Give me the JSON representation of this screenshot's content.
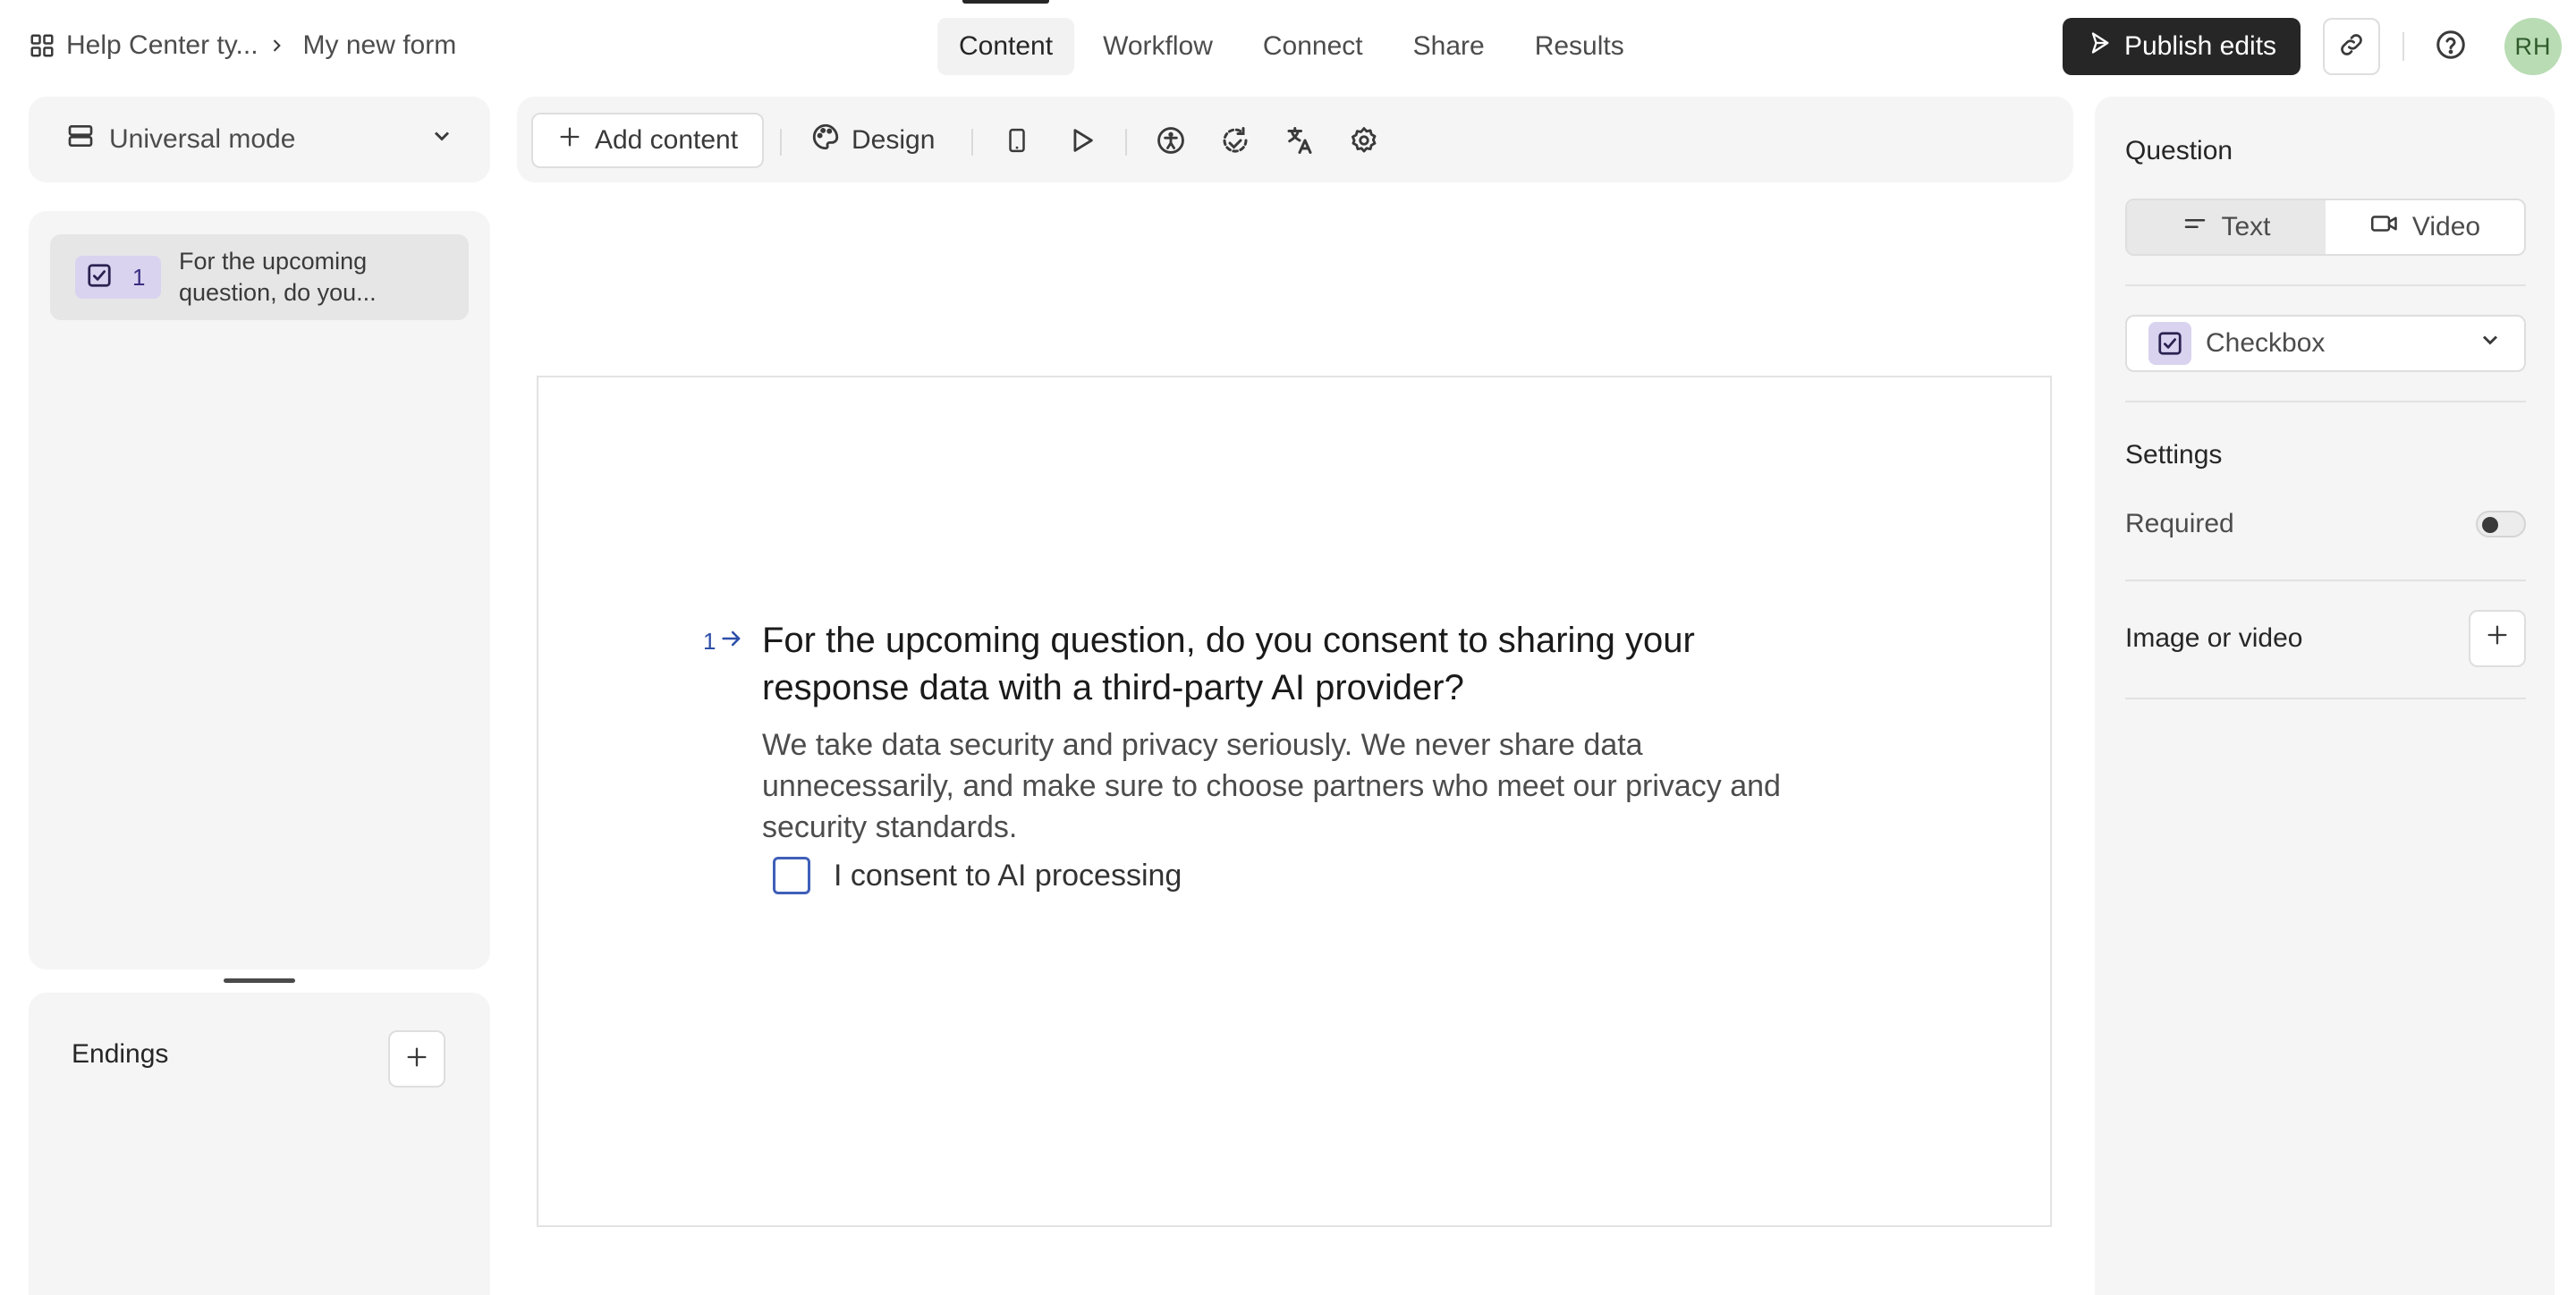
{
  "breadcrumb": {
    "workspace": "Help Center ty...",
    "form_name": "My new form"
  },
  "nav_tabs": [
    {
      "label": "Content",
      "active": true
    },
    {
      "label": "Workflow",
      "active": false
    },
    {
      "label": "Connect",
      "active": false
    },
    {
      "label": "Share",
      "active": false
    },
    {
      "label": "Results",
      "active": false
    }
  ],
  "header": {
    "publish_label": "Publish edits",
    "avatar_initials": "RH"
  },
  "mode": {
    "selected": "Universal mode"
  },
  "question_list": [
    {
      "number": "1",
      "type_icon": "checkbox-icon",
      "label": "For the upcoming question, do you..."
    }
  ],
  "endings": {
    "title": "Endings"
  },
  "toolbar": {
    "add_content_label": "Add content",
    "design_label": "Design"
  },
  "question": {
    "number": "1",
    "title": "For the upcoming question, do you consent to sharing your response data with a third-party AI provider?",
    "description": "We take data security and privacy seriously. We never share data unnecessarily, and make sure to choose partners who meet our privacy and security standards.",
    "choices": [
      {
        "label": "I consent to AI processing",
        "checked": false
      }
    ]
  },
  "right_panel": {
    "question_heading": "Question",
    "format_options": [
      {
        "label": "Text",
        "active": true
      },
      {
        "label": "Video",
        "active": false
      }
    ],
    "type_selected": "Checkbox",
    "settings_heading": "Settings",
    "required_label": "Required",
    "required_on": false,
    "media_label": "Image or video"
  },
  "colors": {
    "accent_dark": "#262627",
    "checkbox_badge": "#d9d3f0",
    "question_number": "#2d4ea8",
    "avatar_bg": "#b9dcb4"
  }
}
